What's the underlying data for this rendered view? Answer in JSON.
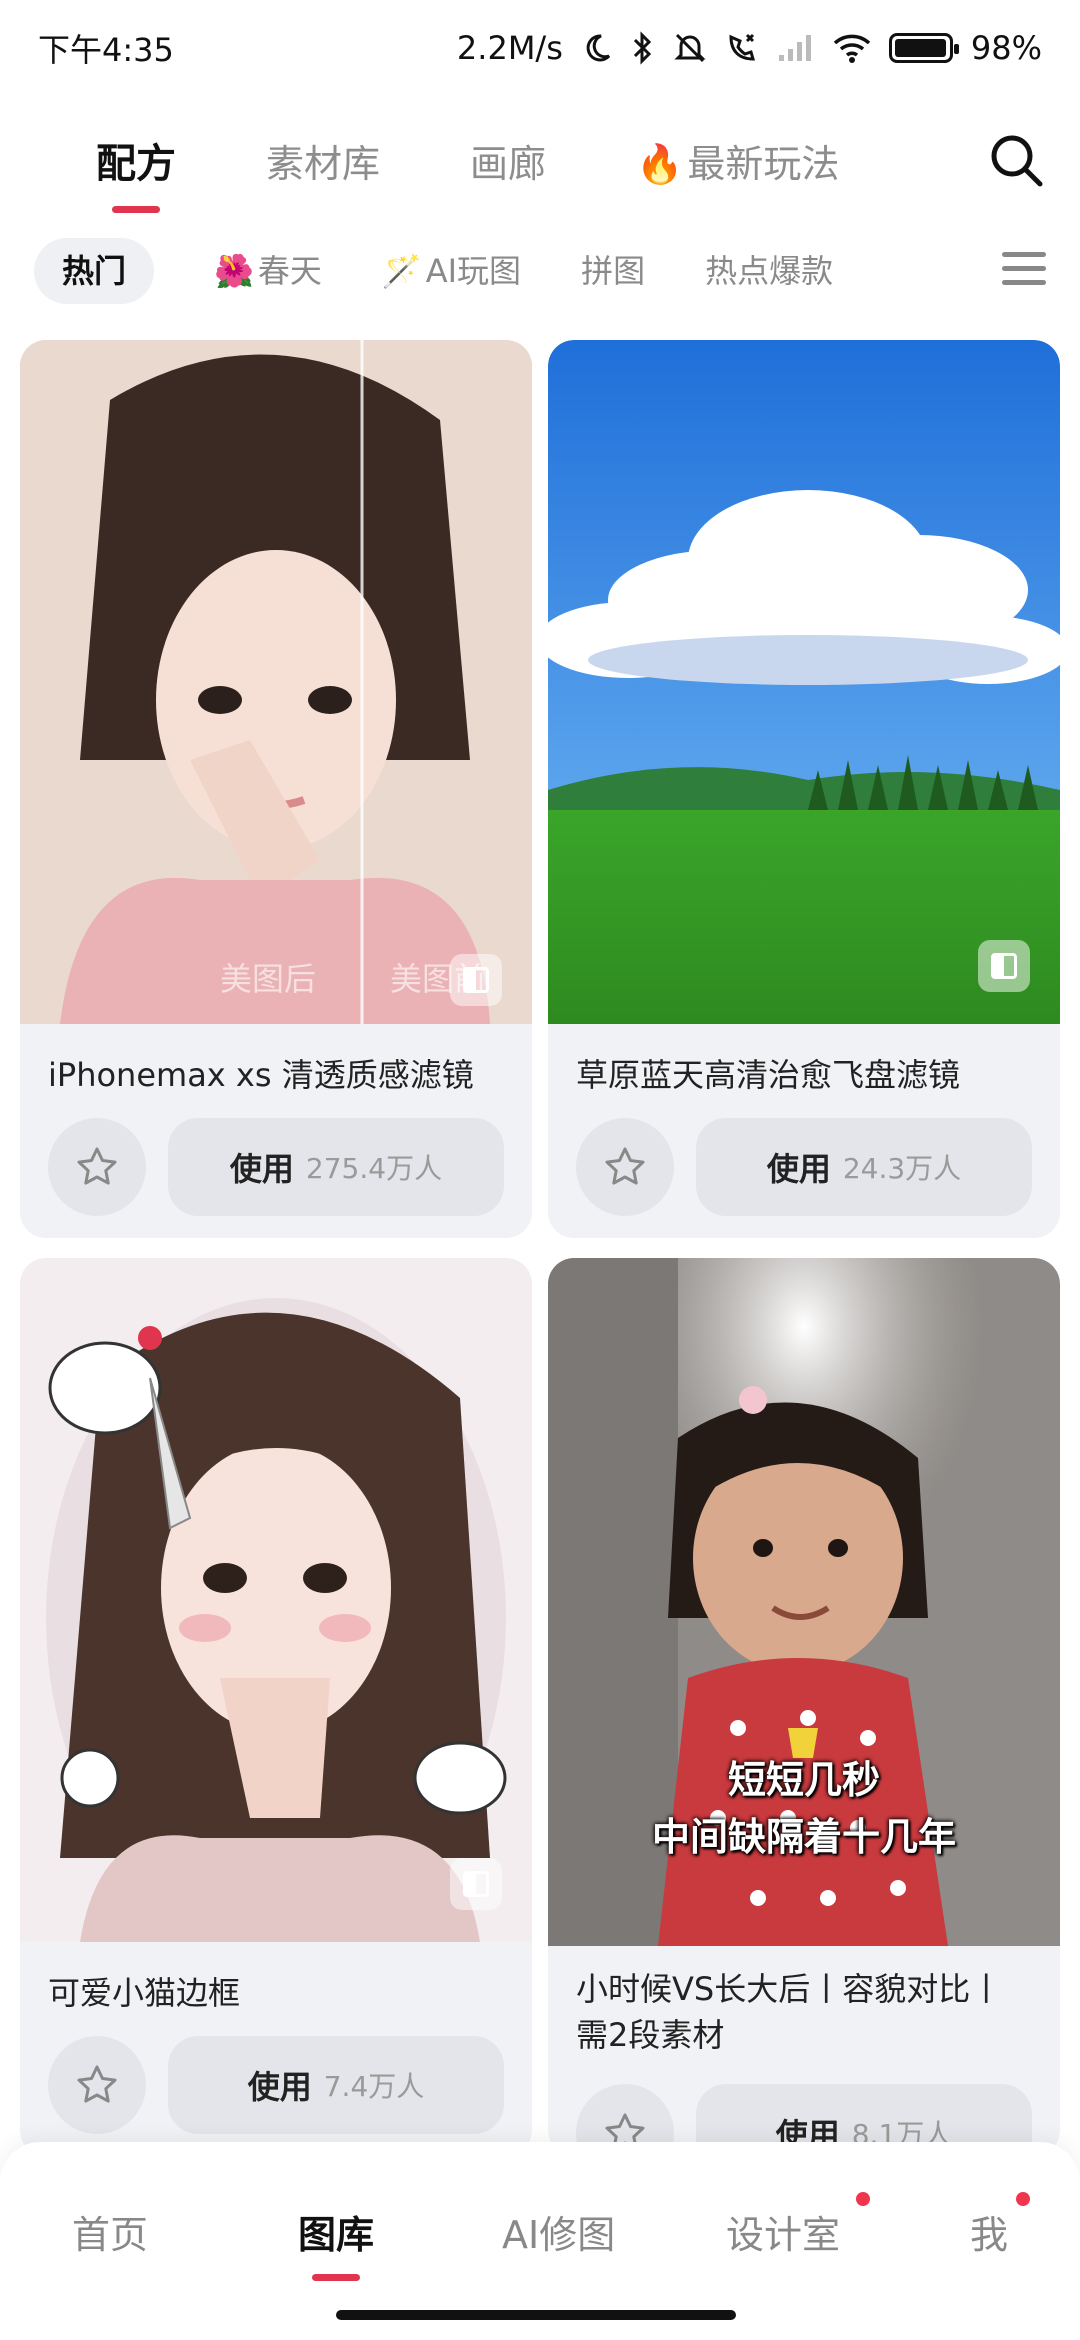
{
  "status_bar": {
    "time": "下午4:35",
    "network_speed": "2.2M/s",
    "battery_percent": "98%",
    "battery_level": 0.98
  },
  "top_tabs": [
    {
      "label": "配方",
      "active": true
    },
    {
      "label": "素材库",
      "active": false
    },
    {
      "label": "画廊",
      "active": false
    },
    {
      "label": "最新玩法",
      "active": false,
      "icon": "fire-icon"
    }
  ],
  "categories": [
    {
      "label": "热门",
      "active": true
    },
    {
      "label": "春天",
      "icon": "flower-icon"
    },
    {
      "label": "AI玩图",
      "icon": "magic-wand-icon"
    },
    {
      "label": "拼图"
    },
    {
      "label": "热点爆款"
    }
  ],
  "cards": [
    {
      "title": "iPhonemax xs 清透质感滤镜",
      "use_label": "使用",
      "use_count": "275.4万人",
      "watermark_left": "美图后",
      "watermark_right": "美图前"
    },
    {
      "title": "草原蓝天高清治愈飞盘滤镜",
      "use_label": "使用",
      "use_count": "24.3万人"
    },
    {
      "title": "可爱小猫边框",
      "use_label": "使用",
      "use_count": "7.4万人"
    },
    {
      "title": "小时候VS长大后丨容貌对比丨需2段素材",
      "use_label": "使用",
      "use_count": "8.1万人",
      "overlay_line1": "短短几秒",
      "overlay_line2": "中间缺隔着十几年"
    }
  ],
  "bottom_nav": [
    {
      "label": "首页",
      "active": false
    },
    {
      "label": "图库",
      "active": true
    },
    {
      "label": "AI修图",
      "active": false
    },
    {
      "label": "设计室",
      "active": false,
      "badge": true
    },
    {
      "label": "我",
      "active": false,
      "badge": true
    }
  ],
  "colors": {
    "accent": "#e0344f",
    "card_bg": "#f1f2f6",
    "button_bg": "#e4e5ea"
  }
}
